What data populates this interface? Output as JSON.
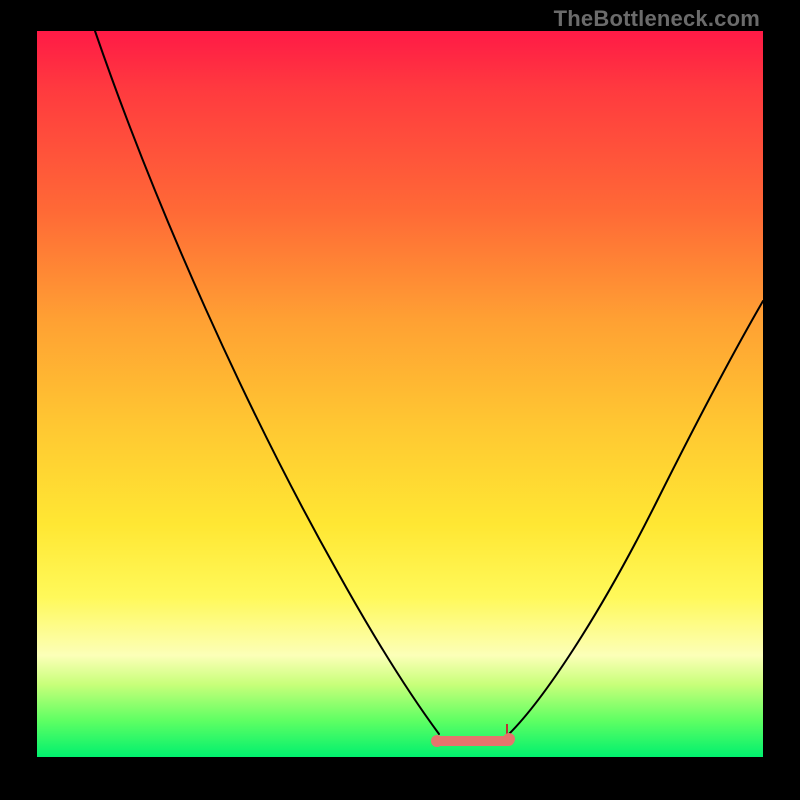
{
  "watermark": "TheBottleneck.com",
  "colors": {
    "frame_bg": "#000000",
    "marker": "#e6746d",
    "curve": "#000000"
  },
  "chart_data": {
    "type": "line",
    "title": "",
    "xlabel": "",
    "ylabel": "",
    "xlim": [
      0,
      100
    ],
    "ylim": [
      0,
      100
    ],
    "grid": false,
    "legend": false,
    "series": [
      {
        "name": "left-branch",
        "x": [
          8,
          15,
          25,
          35,
          45,
          52,
          55
        ],
        "values": [
          100,
          85,
          63,
          41,
          19,
          6,
          2
        ]
      },
      {
        "name": "right-branch",
        "x": [
          65,
          70,
          78,
          88,
          98
        ],
        "values": [
          2,
          8,
          22,
          42,
          62
        ]
      },
      {
        "name": "flat-bottom-marker",
        "x": [
          55,
          65
        ],
        "values": [
          1.5,
          1.5
        ]
      }
    ],
    "annotations": [
      {
        "text": "TheBottleneck.com",
        "pos": "top-right"
      }
    ]
  }
}
